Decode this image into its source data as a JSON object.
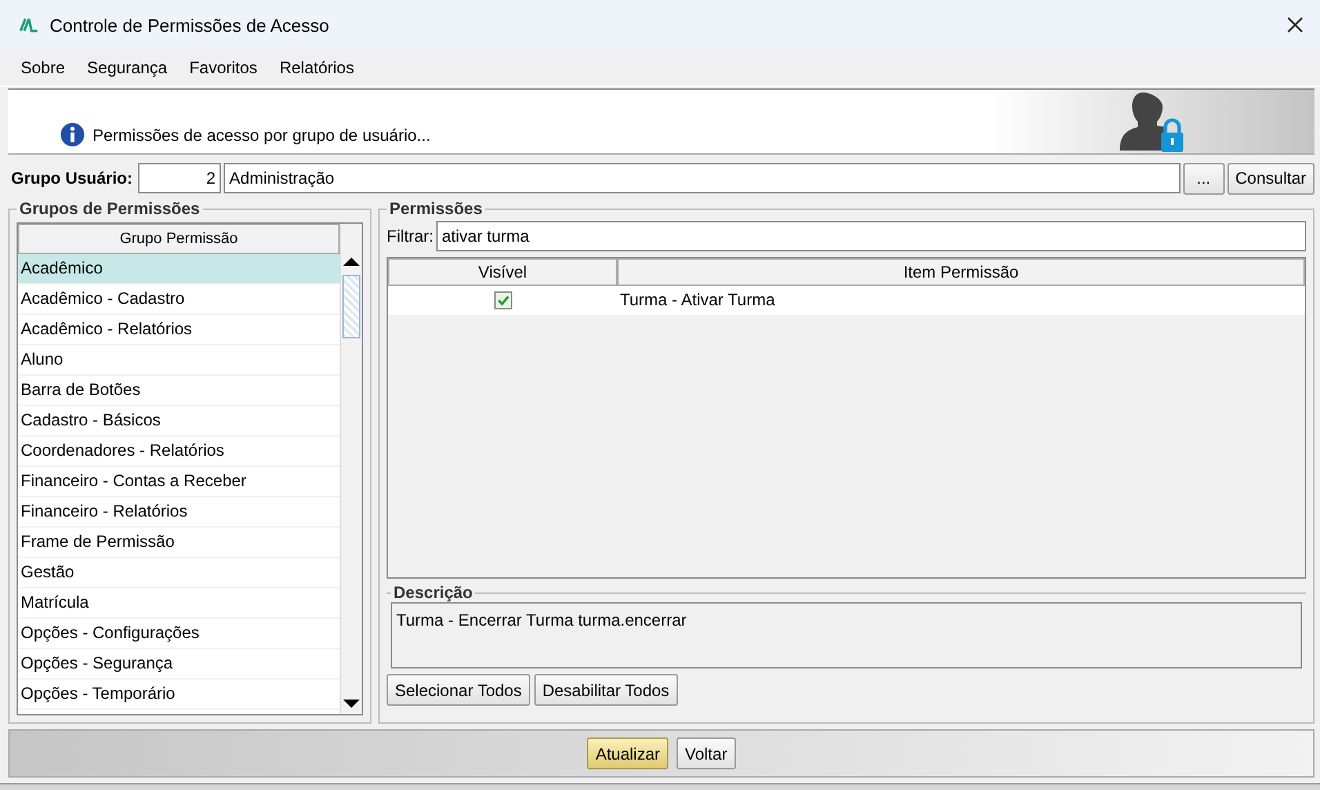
{
  "window": {
    "title": "Controle de Permissões de Acesso"
  },
  "menu": [
    "Sobre",
    "Segurança",
    "Favoritos",
    "Relatórios"
  ],
  "header": {
    "message": "Permissões de acesso por grupo de usuário..."
  },
  "user_group": {
    "label": "Grupo Usuário:",
    "code": "2",
    "name": "Administração",
    "browse_button": "...",
    "search_button": "Consultar"
  },
  "permission_groups": {
    "title": "Grupos de Permissões",
    "column": "Grupo Permissão",
    "items": [
      {
        "label": "Acadêmico",
        "selected": true
      },
      {
        "label": "Acadêmico - Cadastro",
        "selected": false
      },
      {
        "label": "Acadêmico - Relatórios",
        "selected": false
      },
      {
        "label": "Aluno",
        "selected": false
      },
      {
        "label": "Barra de Botões",
        "selected": false
      },
      {
        "label": "Cadastro - Básicos",
        "selected": false
      },
      {
        "label": "Coordenadores - Relatórios",
        "selected": false
      },
      {
        "label": "Financeiro - Contas a Receber",
        "selected": false
      },
      {
        "label": "Financeiro - Relatórios",
        "selected": false
      },
      {
        "label": "Frame de Permissão",
        "selected": false
      },
      {
        "label": "Gestão",
        "selected": false
      },
      {
        "label": "Matrícula",
        "selected": false
      },
      {
        "label": "Opções - Configurações",
        "selected": false
      },
      {
        "label": "Opções - Segurança",
        "selected": false
      },
      {
        "label": "Opções - Temporário",
        "selected": false
      }
    ]
  },
  "permissions": {
    "title": "Permissões",
    "filter_label": "Filtrar:",
    "filter_value": "ativar turma",
    "columns": [
      "Visível",
      "Item Permissão"
    ],
    "rows": [
      {
        "visible": true,
        "item": "Turma - Ativar Turma"
      }
    ],
    "description_title": "Descrição",
    "description": "Turma - Encerrar Turma turma.encerrar",
    "buttons": [
      "Selecionar Todos",
      "Desabilitar Todos"
    ]
  },
  "footer_buttons": [
    {
      "label": "Atualizar",
      "default": true
    },
    {
      "label": "Voltar",
      "default": false
    }
  ]
}
